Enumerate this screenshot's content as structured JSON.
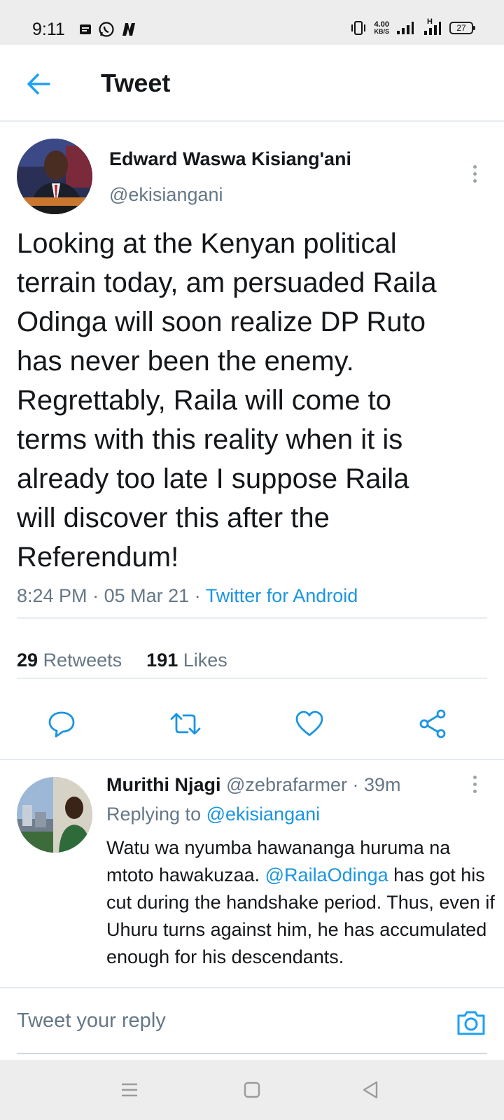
{
  "status_bar": {
    "time": "9:11",
    "speed_value": "4.00",
    "speed_unit": "KB/S",
    "network": "H",
    "battery": "27"
  },
  "header": {
    "title": "Tweet"
  },
  "tweet": {
    "author_name": "Edward Waswa Kisiang'ani",
    "author_handle": "@ekisiangani",
    "text": "Looking at the Kenyan political\nterrain today, am persuaded Raila\nOdinga will soon realize DP Ruto\nhas never been the enemy.\nRegrettably, Raila will come to\nterms with this reality when it is\nalready too late  I suppose Raila\nwill discover this after  the\nReferendum!",
    "time": "8:24 PM",
    "date": "05 Mar 21",
    "source": "Twitter for Android",
    "retweet_count": "29",
    "retweet_label": "Retweets",
    "like_count": "191",
    "like_label": "Likes"
  },
  "reply": {
    "author_name": "Murithi Njagi",
    "author_handle": "@zebrafarmer",
    "age": "39m",
    "replying_label": "Replying to",
    "replying_to": "@ekisiangani",
    "text_part1": "Watu wa nyumba hawananga huruma na mtoto hawakuzaa. ",
    "mention": "@RailaOdinga",
    "text_part2": " has got his cut during the handshake period. Thus, even if Uhuru turns against him, he has accumulated enough for his descendants."
  },
  "compose": {
    "placeholder": "Tweet your reply"
  },
  "icons": {
    "back": "arrow-left-icon",
    "more": "more-vertical-icon",
    "reply": "comment-icon",
    "retweet": "retweet-icon",
    "like": "heart-icon",
    "share": "share-icon",
    "camera": "camera-icon"
  },
  "colors": {
    "accent": "#1da1f2",
    "link": "#1b95e0",
    "secondary_text": "#657786",
    "primary_text": "#14171a"
  }
}
